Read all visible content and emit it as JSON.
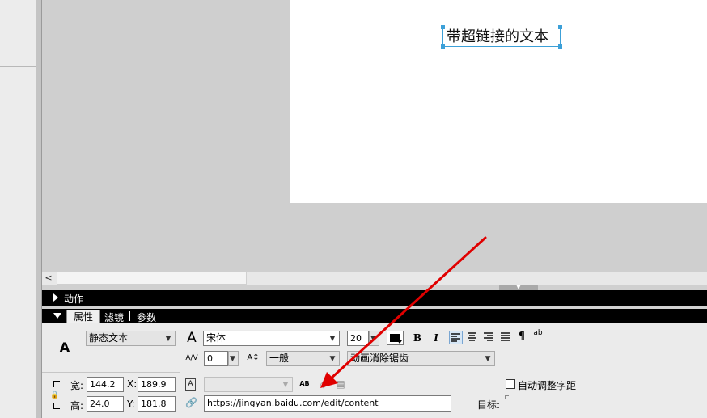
{
  "stage": {
    "selected_text": "带超链接的文本"
  },
  "panels": {
    "actions": {
      "label": "动作"
    },
    "tabs": [
      {
        "label": "属性"
      },
      {
        "label": "滤镜"
      },
      {
        "label": "参数"
      }
    ]
  },
  "properties": {
    "text_type": "静态文本",
    "font_family": "宋体",
    "font_size": "20",
    "text_color": "#000000",
    "letter_spacing": "0",
    "baseline": "一般",
    "anti_alias": "动画消除锯齿",
    "width_label": "宽:",
    "width_value": "144.2",
    "height_label": "高:",
    "height_value": "24.0",
    "x_label": "X:",
    "x_value": "189.9",
    "y_label": "Y:",
    "y_value": "181.8",
    "url": "https://jingyan.baidu.com/edit/content",
    "auto_kern_label": "自动调整字距",
    "target_label": "目标:",
    "icons": {
      "text_tool": "A",
      "font": "A",
      "letter_spacing": "A/V",
      "baseline": "A↕",
      "bold": "B",
      "italic": "I",
      "paragraph": "¶",
      "ab": "ab"
    }
  },
  "annotation": {
    "arrow_color": "#e00000"
  }
}
